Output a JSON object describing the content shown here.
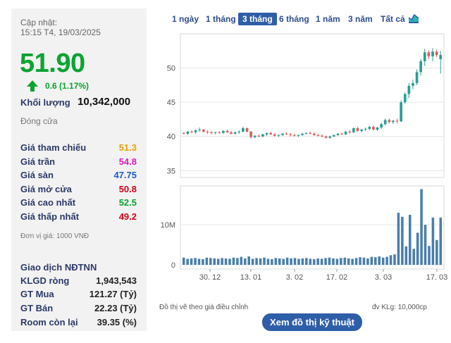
{
  "update": {
    "label": "Cập nhật:",
    "datetime": "15:15 T4, 19/03/2025"
  },
  "price": {
    "current": "51.90",
    "change": "0.6 (1.17%)",
    "direction": "up",
    "color": "#0ba331"
  },
  "volume": {
    "label": "Khối lượng",
    "value": "10,342,000"
  },
  "status": "Đóng cửa",
  "stats": [
    {
      "label": "Giá tham chiếu",
      "value": "51.3",
      "color": "#e6a100"
    },
    {
      "label": "Giá trần",
      "value": "54.8",
      "color": "#d21dbf"
    },
    {
      "label": "Giá sàn",
      "value": "47.75",
      "color": "#1e5bc6"
    },
    {
      "label": "Giá mở cửa",
      "value": "50.8",
      "color": "#d0021b"
    },
    {
      "label": "Giá cao nhất",
      "value": "52.5",
      "color": "#0ba331"
    },
    {
      "label": "Giá thấp nhất",
      "value": "49.2",
      "color": "#d0021b"
    }
  ],
  "unit": "Đơn vị giá: 1000 VNĐ",
  "foreign": {
    "title": "Giao dịch NĐTNN",
    "rows": [
      {
        "label": "KLGD ròng",
        "value": "1,943,543"
      },
      {
        "label": "GT Mua",
        "value": "121.27 (Tỷ)"
      },
      {
        "label": "GT Bán",
        "value": "22.23 (Tỷ)"
      },
      {
        "label": "Room còn lại",
        "value": "39.35 (%)"
      }
    ]
  },
  "tabs": [
    {
      "label": "1 ngày",
      "active": false
    },
    {
      "label": "1 tháng",
      "active": false
    },
    {
      "label": "3 tháng",
      "active": true
    },
    {
      "label": "6 tháng",
      "active": false
    },
    {
      "label": "1 năm",
      "active": false
    },
    {
      "label": "3 năm",
      "active": false
    },
    {
      "label": "Tất cả",
      "active": false
    }
  ],
  "tab_icon": "chart-icon",
  "notes": {
    "left": "Đồ thị vẽ theo giá điều chỉnh",
    "right": "đv KLg: 10,000cp"
  },
  "button": {
    "label": "Xem đồ thị kỹ thuật"
  },
  "chart_data": [
    {
      "type": "candlestick",
      "y_ticks": [
        35,
        40,
        45,
        50
      ],
      "ylim": [
        34,
        55
      ],
      "x_ticks": [
        "30. 12",
        "13. 01",
        "3. 02",
        "17. 02",
        "3. 03",
        "17. 03"
      ],
      "up_color": "#2a9d8f",
      "down_color": "#e05c5c",
      "ohlc": [
        [
          40.5,
          40.6,
          40.3,
          40.4
        ],
        [
          40.4,
          40.8,
          40.2,
          40.7
        ],
        [
          40.7,
          40.9,
          40.5,
          40.6
        ],
        [
          40.6,
          41.0,
          40.4,
          40.9
        ],
        [
          40.9,
          41.3,
          40.7,
          41.0
        ],
        [
          41.0,
          41.1,
          40.6,
          40.7
        ],
        [
          40.7,
          40.9,
          40.4,
          40.6
        ],
        [
          40.6,
          40.8,
          40.3,
          40.5
        ],
        [
          40.5,
          40.7,
          40.3,
          40.6
        ],
        [
          40.6,
          40.8,
          40.4,
          40.5
        ],
        [
          40.5,
          40.9,
          40.4,
          40.8
        ],
        [
          40.8,
          41.0,
          40.5,
          40.6
        ],
        [
          40.6,
          40.8,
          40.3,
          40.4
        ],
        [
          40.4,
          40.7,
          40.3,
          40.6
        ],
        [
          40.6,
          40.9,
          40.4,
          40.7
        ],
        [
          40.7,
          41.4,
          40.6,
          41.2
        ],
        [
          41.2,
          41.3,
          40.6,
          40.7
        ],
        [
          40.7,
          40.8,
          39.7,
          39.9
        ],
        [
          39.9,
          40.2,
          39.7,
          40.1
        ],
        [
          40.1,
          40.3,
          39.9,
          40.0
        ],
        [
          40.0,
          40.4,
          39.9,
          40.3
        ],
        [
          40.3,
          40.6,
          40.1,
          40.5
        ],
        [
          40.5,
          40.7,
          40.2,
          40.3
        ],
        [
          40.3,
          40.5,
          40.0,
          40.1
        ],
        [
          40.1,
          40.3,
          39.9,
          40.2
        ],
        [
          40.2,
          40.5,
          40.1,
          40.4
        ],
        [
          40.4,
          40.6,
          40.2,
          40.3
        ],
        [
          40.3,
          40.5,
          40.0,
          40.2
        ],
        [
          40.2,
          40.4,
          40.0,
          40.1
        ],
        [
          40.1,
          40.3,
          39.9,
          40.2
        ],
        [
          40.2,
          40.5,
          40.1,
          40.4
        ],
        [
          40.4,
          40.6,
          40.3,
          40.5
        ],
        [
          40.5,
          40.7,
          40.3,
          40.4
        ],
        [
          40.4,
          40.6,
          40.1,
          40.2
        ],
        [
          40.2,
          40.4,
          40.0,
          40.1
        ],
        [
          40.1,
          40.3,
          39.9,
          40.0
        ],
        [
          40.0,
          40.1,
          39.7,
          39.8
        ],
        [
          39.8,
          40.1,
          39.7,
          40.0
        ],
        [
          40.0,
          40.3,
          39.9,
          40.2
        ],
        [
          40.2,
          40.5,
          40.1,
          40.4
        ],
        [
          40.4,
          40.6,
          40.2,
          40.3
        ],
        [
          40.3,
          40.8,
          40.2,
          40.7
        ],
        [
          40.7,
          41.0,
          40.4,
          40.6
        ],
        [
          40.6,
          41.3,
          40.5,
          41.2
        ],
        [
          41.2,
          41.4,
          40.7,
          40.8
        ],
        [
          40.8,
          41.1,
          40.6,
          41.0
        ],
        [
          41.0,
          41.3,
          40.8,
          41.1
        ],
        [
          41.1,
          41.5,
          40.9,
          41.4
        ],
        [
          41.4,
          41.6,
          40.9,
          41.0
        ],
        [
          41.0,
          41.4,
          40.8,
          41.3
        ],
        [
          41.3,
          42.0,
          41.1,
          41.8
        ],
        [
          41.8,
          42.6,
          41.6,
          42.4
        ],
        [
          42.4,
          42.6,
          41.9,
          42.1
        ],
        [
          42.1,
          42.4,
          41.8,
          42.3
        ],
        [
          42.3,
          42.6,
          41.9,
          42.2
        ],
        [
          42.2,
          45.3,
          42.1,
          45.0
        ],
        [
          45.0,
          46.4,
          44.8,
          46.2
        ],
        [
          46.2,
          47.8,
          45.6,
          47.4
        ],
        [
          47.4,
          48.3,
          46.9,
          47.8
        ],
        [
          47.8,
          49.8,
          47.5,
          49.4
        ],
        [
          49.4,
          51.3,
          48.9,
          51.0
        ],
        [
          51.0,
          52.8,
          50.3,
          52.3
        ],
        [
          52.3,
          52.6,
          51.3,
          51.7
        ],
        [
          51.7,
          52.9,
          51.0,
          52.4
        ],
        [
          52.4,
          52.7,
          51.6,
          51.9
        ],
        [
          51.3,
          52.5,
          49.2,
          51.9
        ]
      ]
    },
    {
      "type": "bar",
      "y_ticks": [
        "0",
        "10M"
      ],
      "ylim": [
        0,
        1900
      ],
      "unit": "10,000cp",
      "values": [
        180,
        150,
        160,
        170,
        150,
        140,
        180,
        170,
        160,
        150,
        170,
        160,
        150,
        180,
        170,
        200,
        160,
        210,
        150,
        170,
        160,
        180,
        150,
        140,
        170,
        160,
        150,
        180,
        160,
        170,
        150,
        160,
        170,
        150,
        140,
        160,
        150,
        170,
        180,
        160,
        150,
        170,
        180,
        160,
        150,
        170,
        190,
        180,
        160,
        200,
        190,
        210,
        180,
        200,
        240,
        260,
        1300,
        1200,
        460,
        1250,
        400,
        800,
        1890,
        1000,
        470,
        1180,
        620,
        1180
      ]
    }
  ]
}
